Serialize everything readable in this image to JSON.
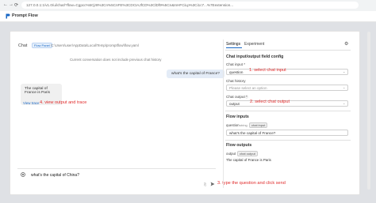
{
  "browser": {
    "url": "127.0.0.1:1/v1.0/ui/chat/?flow=Cgpcc%5Cjr8%3Cn%5CnFE%3CDCIAJfCD%3ClDf9%5Cn&InHFCiLp%3Ci1c7...%7Eextension...",
    "back_label": "←",
    "forward_label": "→",
    "reload_label": "⟳"
  },
  "app": {
    "title": "Prompt Flow"
  },
  "chat": {
    "label": "Chat",
    "flow_badge": "Flow Panel",
    "flow_path": "C:\\Users\\user\\AppData\\Local\\Temp\\promptflow\\flow.yaml",
    "notice": "Current conversation does not include previous chat history",
    "user_message": "what's the capital of France?",
    "bot_message": "The capital of France is Paris",
    "view_trace": "View trace",
    "input_value": "what's the capital of China?",
    "send_icon": "send-icon"
  },
  "annotations": {
    "a1": "1. select chat input",
    "a2": "2. select chat output",
    "a3": "3. type the question and click send",
    "a4": "4. view output and trace"
  },
  "right": {
    "tabs": [
      "Settings",
      "Experiment"
    ],
    "config_title": "Chat input/output field config",
    "chat_input_label": "Chat input *",
    "chat_input_value": "question",
    "chat_history_label": "Chat history",
    "chat_history_placeholder": "Please select an option",
    "chat_output_label": "Chat output *",
    "chat_output_value": "output",
    "flow_inputs_title": "Flow inputs",
    "question_label": "question",
    "question_type": "string",
    "question_badge": "chat input",
    "question_value": "what's the capital of France?",
    "flow_outputs_title": "Flow outputs",
    "output_label": "output",
    "output_badge": "chat output",
    "output_value": "The capital of France is Paris"
  },
  "colors": {
    "accent": "#1766c4",
    "annotation": "#e02b2b"
  }
}
